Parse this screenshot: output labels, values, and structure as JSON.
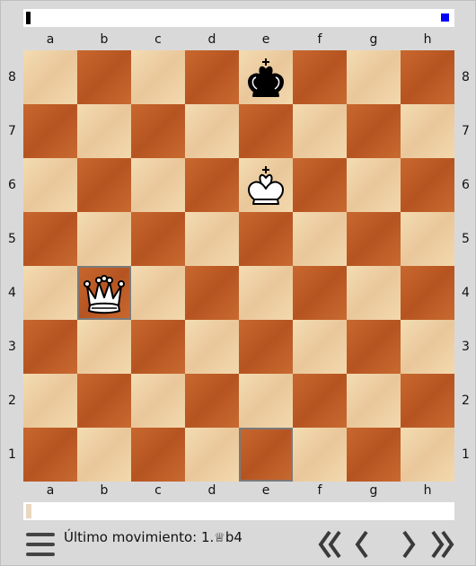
{
  "board": {
    "files": [
      "a",
      "b",
      "c",
      "d",
      "e",
      "f",
      "g",
      "h"
    ],
    "ranks": [
      "8",
      "7",
      "6",
      "5",
      "4",
      "3",
      "2",
      "1"
    ],
    "pieces": [
      {
        "square": "e8",
        "piece": "black-king"
      },
      {
        "square": "e6",
        "piece": "white-king"
      },
      {
        "square": "b4",
        "piece": "white-queen"
      }
    ],
    "highlighted_squares": [
      "b4",
      "e1"
    ],
    "colors": {
      "light": "#f2d7ab",
      "dark": "#c0612a",
      "highlight": "#7a7a7a"
    }
  },
  "status": {
    "last_move_label": "Último movimiento: 1.",
    "last_move_piece": "♕",
    "last_move_square": "b4"
  },
  "nav": {
    "first": "《",
    "prev": "〈",
    "next": "〉",
    "last": "》"
  },
  "indicators": {
    "top_left_color": "#000000",
    "top_right_color": "#0000ff"
  }
}
